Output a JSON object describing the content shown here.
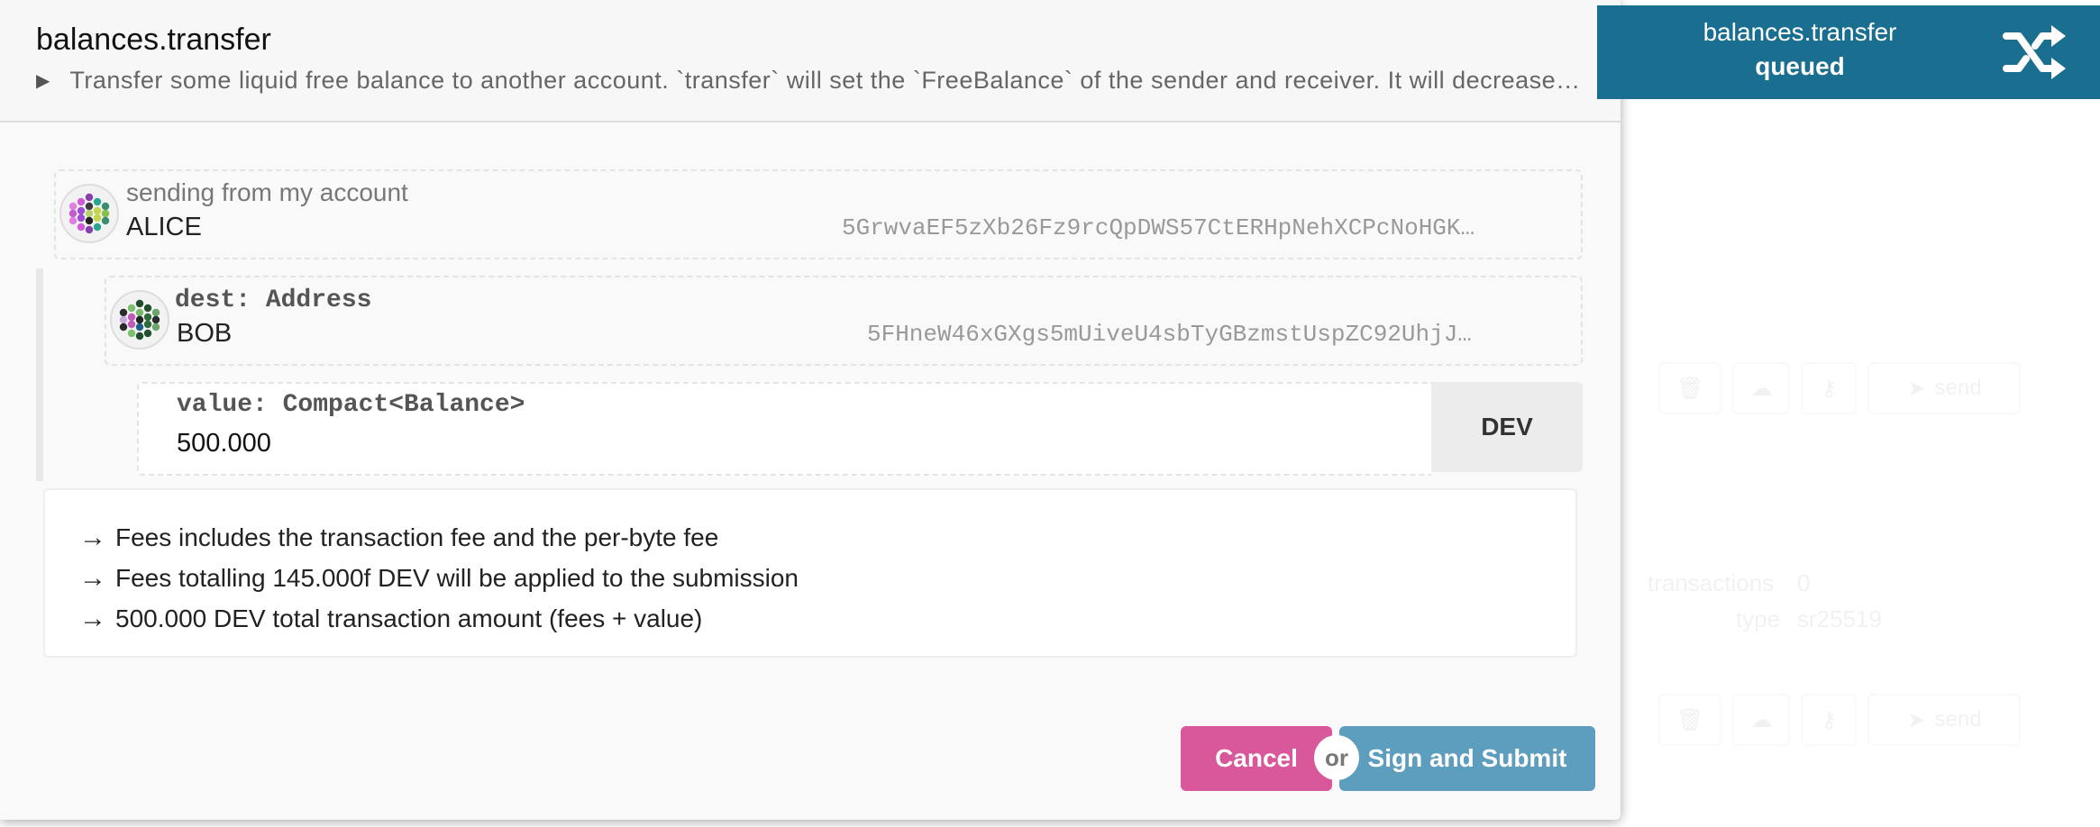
{
  "background": {
    "row1_send": "send",
    "row2_send": "send",
    "transactions_label": "transactions",
    "transactions_value": "0",
    "type_label": "type",
    "type_value": "sr25519"
  },
  "modal": {
    "title": "balances.transfer",
    "description": "Transfer some liquid free balance to another account. `transfer` will set the `FreeBalance` of the sender and receiver. It will decrease the total issuance of the system by the `TransferFee`.",
    "sender": {
      "label": "sending from my account",
      "name": "ALICE",
      "address": "5GrwvaEF5zXb26Fz9rcQpDWS57CtERHpNehXCPcNoHGK…"
    },
    "dest": {
      "label": "dest: Address",
      "name": "BOB",
      "address": "5FHneW46xGXgs5mUiveU4sbTyGBzmstUspZC92UhjJ…"
    },
    "value": {
      "label": "value: Compact<Balance>",
      "amount": "500.000",
      "unit": "DEV"
    },
    "fees": [
      "Fees includes the transaction fee and the per-byte fee",
      "Fees totalling 145.000f DEV will be applied to the submission",
      "500.000 DEV total transaction amount (fees + value)"
    ],
    "buttons": {
      "cancel": "Cancel",
      "or": "or",
      "submit": "Sign and Submit"
    }
  },
  "toast": {
    "title": "balances.transfer",
    "status": "queued",
    "icon": "shuffle-icon",
    "color": "#1a6e8f"
  },
  "colors": {
    "cancel": "#d9579b",
    "submit": "#5d9dbd"
  }
}
